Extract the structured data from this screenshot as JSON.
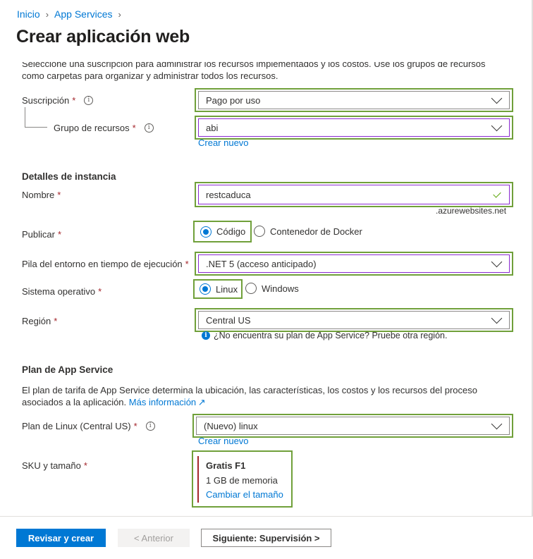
{
  "breadcrumb": {
    "home": "Inicio",
    "section": "App Services"
  },
  "page_title": "Crear aplicación web",
  "intro": "Seleccione una suscripción para administrar los recursos implementados y los costos. Use los grupos de recursos como carpetas para organizar y administrar todos los recursos.",
  "required_mark": "*",
  "subscription": {
    "label": "Suscripción",
    "value": "Pago por uso"
  },
  "resource_group": {
    "label": "Grupo de recursos",
    "value": "abi",
    "create_link": "Crear nuevo"
  },
  "instance_details": {
    "heading": "Detalles de instancia",
    "name": {
      "label": "Nombre",
      "value": "restcaduca",
      "suffix": ".azurewebsites.net"
    },
    "publish": {
      "label": "Publicar",
      "options": [
        "Código",
        "Contenedor de Docker"
      ],
      "selected": "Código"
    },
    "runtime": {
      "label": "Pila del entorno en tiempo de ejecución",
      "value": ".NET 5 (acceso anticipado)"
    },
    "os": {
      "label": "Sistema operativo",
      "options": [
        "Linux",
        "Windows"
      ],
      "selected": "Linux"
    },
    "region": {
      "label": "Región",
      "value": "Central US",
      "hint": "¿No encuentra su plan de App Service? Pruebe otra región."
    }
  },
  "app_service_plan": {
    "heading": "Plan de App Service",
    "description": "El plan de tarifa de App Service determina la ubicación, las características, los costos y los recursos del proceso asociados a la aplicación.",
    "more_info_link": "Más información",
    "linux_plan": {
      "label": "Plan de Linux (Central US)",
      "value": "(Nuevo) linux",
      "create_link": "Crear nuevo"
    },
    "sku": {
      "label": "SKU y tamaño",
      "tier": "Gratis F1",
      "memory": "1 GB de memoria",
      "change_link": "Cambiar el tamaño"
    }
  },
  "footer": {
    "review_create": "Revisar y crear",
    "previous": "< Anterior",
    "next": "Siguiente: Supervisión >"
  },
  "colors": {
    "accent": "#0078d4",
    "highlight": "#70a03a",
    "required": "#a4262c",
    "focus": "#8a2ad0"
  }
}
